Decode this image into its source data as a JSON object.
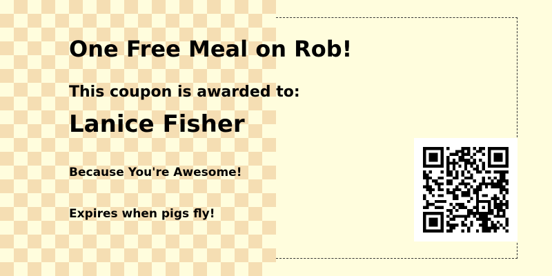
{
  "coupon": {
    "title": "One Free Meal on Rob!",
    "awarded_label": "This coupon is awarded to:",
    "recipient": "Lanice Fisher",
    "reason": "Because You're Awesome!",
    "expiry": "Expires when pigs fly!"
  },
  "colors": {
    "background": "#fffddd",
    "checker": "#f5deb3",
    "text": "#000000",
    "qr": "#000000"
  },
  "icons": {
    "qr": "qr-code-icon"
  }
}
